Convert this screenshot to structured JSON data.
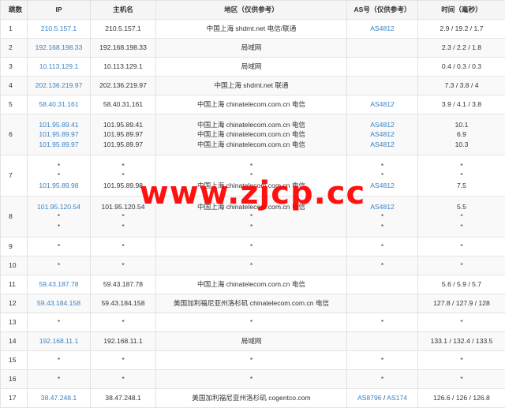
{
  "headers": [
    "跳数",
    "IP",
    "主机名",
    "地区（仅供参考）",
    "AS号（仅供参考）",
    "时间（毫秒）"
  ],
  "rows": [
    {
      "hop": "1",
      "lines": [
        {
          "ip": "210.5.157.1",
          "host": "210.5.157.1",
          "region": "中国上海 shdmt.net 电信/联通",
          "as": [
            "AS4812"
          ],
          "time": "2.9 / 19.2 / 1.7"
        }
      ]
    },
    {
      "hop": "2",
      "lines": [
        {
          "ip": "192.168.198.33",
          "host": "192.168.198.33",
          "region": "局域网",
          "as": [],
          "time": "2.3 / 2.2 / 1.8"
        }
      ]
    },
    {
      "hop": "3",
      "lines": [
        {
          "ip": "10.113.129.1",
          "host": "10.113.129.1",
          "region": "局域网",
          "as": [],
          "time": "0.4 / 0.3 / 0.3"
        }
      ]
    },
    {
      "hop": "4",
      "lines": [
        {
          "ip": "202.136.219.97",
          "host": "202.136.219.97",
          "region": "中国上海 shdmt.net 联通",
          "as": [],
          "time": "7.3 / 3.8 / 4"
        }
      ]
    },
    {
      "hop": "5",
      "lines": [
        {
          "ip": "58.40.31.161",
          "host": "58.40.31.161",
          "region": "中国上海 chinatelecom.com.cn 电信",
          "as": [
            "AS4812"
          ],
          "time": "3.9 / 4.1 / 3.8"
        }
      ]
    },
    {
      "hop": "6",
      "lines": [
        {
          "ip": "101.95.89.41",
          "host": "101.95.89.41",
          "region": "中国上海 chinatelecom.com.cn 电信",
          "as": [
            "AS4812"
          ],
          "time": "10.1"
        },
        {
          "ip": "101.95.89.97",
          "host": "101.95.89.97",
          "region": "中国上海 chinatelecom.com.cn 电信",
          "as": [
            "AS4812"
          ],
          "time": "6.9"
        },
        {
          "ip": "101.95.89.97",
          "host": "101.95.89.97",
          "region": "中国上海 chinatelecom.com.cn 电信",
          "as": [
            "AS4812"
          ],
          "time": "10.3"
        }
      ]
    },
    {
      "hop": "7",
      "lines": [
        {
          "ip": "*",
          "host": "*",
          "region": "*",
          "as": [
            "*"
          ],
          "time": "*"
        },
        {
          "ip": "*",
          "host": "*",
          "region": "*",
          "as": [
            "*"
          ],
          "time": "*"
        },
        {
          "ip": "101.95.89.98",
          "host": "101.95.89.98",
          "region": "中国上海 chinatelecom.com.cn 电信",
          "as": [
            "AS4812"
          ],
          "time": "7.5"
        }
      ]
    },
    {
      "hop": "8",
      "lines": [
        {
          "ip": "101.95.120.54",
          "host": "101.95.120.54",
          "region": "中国上海 chinatelecom.com.cn 电信",
          "as": [
            "AS4812"
          ],
          "time": "5.5"
        },
        {
          "ip": "*",
          "host": "*",
          "region": "*",
          "as": [
            "*"
          ],
          "time": "*"
        },
        {
          "ip": "*",
          "host": "*",
          "region": "*",
          "as": [
            "*"
          ],
          "time": "*"
        }
      ]
    },
    {
      "hop": "9",
      "lines": [
        {
          "ip": "*",
          "host": "*",
          "region": "*",
          "as": [
            "*"
          ],
          "time": "*"
        }
      ]
    },
    {
      "hop": "10",
      "lines": [
        {
          "ip": "*",
          "host": "*",
          "region": "*",
          "as": [
            "*"
          ],
          "time": "*"
        }
      ]
    },
    {
      "hop": "11",
      "lines": [
        {
          "ip": "59.43.187.78",
          "host": "59.43.187.78",
          "region": "中国上海 chinatelecom.com.cn 电信",
          "as": [],
          "time": "5.6 / 5.9 / 5.7"
        }
      ]
    },
    {
      "hop": "12",
      "lines": [
        {
          "ip": "59.43.184.158",
          "host": "59.43.184.158",
          "region": "美国加利福尼亚州洛杉矶 chinatelecom.com.cn 电信",
          "as": [],
          "time": "127.8 / 127.9 / 128"
        }
      ]
    },
    {
      "hop": "13",
      "lines": [
        {
          "ip": "*",
          "host": "*",
          "region": "*",
          "as": [
            "*"
          ],
          "time": "*"
        }
      ]
    },
    {
      "hop": "14",
      "lines": [
        {
          "ip": "192.168.11.1",
          "host": "192.168.11.1",
          "region": "局域网",
          "as": [],
          "time": "133.1 / 132.4 / 133.5"
        }
      ]
    },
    {
      "hop": "15",
      "lines": [
        {
          "ip": "*",
          "host": "*",
          "region": "*",
          "as": [
            "*"
          ],
          "time": "*"
        }
      ]
    },
    {
      "hop": "16",
      "lines": [
        {
          "ip": "*",
          "host": "*",
          "region": "*",
          "as": [
            "*"
          ],
          "time": "*"
        }
      ]
    },
    {
      "hop": "17",
      "lines": [
        {
          "ip": "38.47.248.1",
          "host": "38.47.248.1",
          "region": "美国加利福尼亚州洛杉矶 cogentco.com",
          "as": [
            "AS8796",
            "AS174"
          ],
          "time": "126.6 / 126 / 126.8"
        }
      ]
    }
  ],
  "as_separator": " / ",
  "watermark": "www.zjcp.cc",
  "colors": {
    "link": "#3a82c4",
    "header_bg": "#f5f5f5",
    "border": "#e3e3e3",
    "watermark": "#ff0000"
  }
}
